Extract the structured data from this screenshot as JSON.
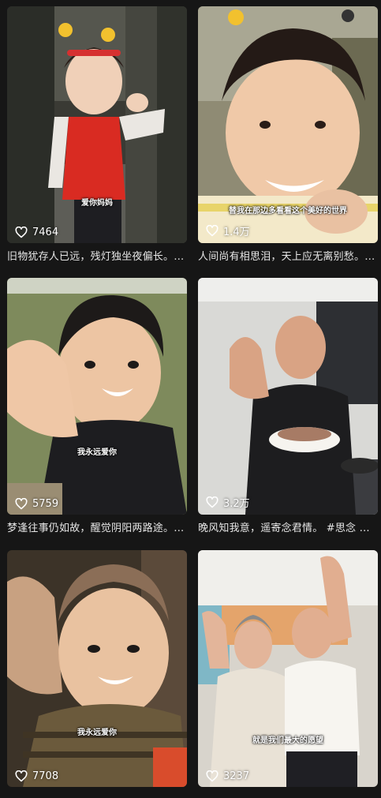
{
  "feed": {
    "items": [
      {
        "overlay": "爱你妈妈",
        "likes": "7464",
        "title": "旧物犹存人已远，残灯独坐夜偏长。#思念"
      },
      {
        "overlay": "替我在那边多看看这个美好的世界",
        "likes": "1.4万",
        "title": "人间尚有相思泪，天上应无离别愁。#思念"
      },
      {
        "overlay": "我永远爱你",
        "likes": "5759",
        "title": "梦逢往事仍如故，醒觉阴阳两路途。#思念"
      },
      {
        "overlay": "",
        "likes": "3.2万",
        "title": "晚风知我意，遥寄念君情。 #思念 #怀念"
      },
      {
        "overlay": "我永远爱你",
        "likes": "7708",
        "title": ""
      },
      {
        "overlay": "就是我们最大的愿望",
        "likes": "3237",
        "title": ""
      }
    ]
  },
  "colors": {
    "background": "#161616",
    "text": "#e6e6e6"
  },
  "icons": {
    "like": "heart-outline-icon"
  }
}
